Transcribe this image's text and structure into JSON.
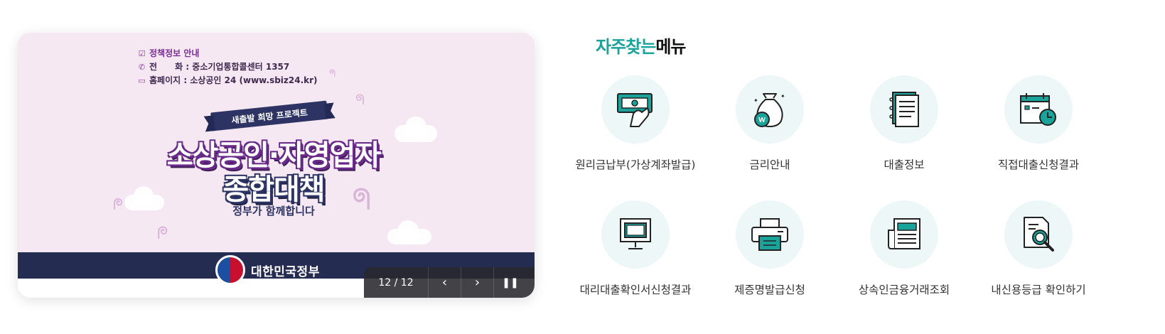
{
  "banner": {
    "info_title": "정책정보 안내",
    "phone_label": "전      화 : 중소기업통합콜센터 1357",
    "homepage_label": "홈페이지 : 소상공인 24 (www.sbiz24.kr)",
    "ribbon": "새출발 희망 프로젝트",
    "headline_line1": "소상공인·자영업자",
    "headline_line2": "종합대책",
    "tagline": "정부가 함께합니다",
    "gov_name": "대한민국정부",
    "counter": "12 / 12",
    "colors": {
      "navy": "#252c52",
      "purple": "#6a2a8a",
      "bg": "#f6e8f3"
    }
  },
  "quick_menu": {
    "title_accent": "자주찾는",
    "title_rest": "메뉴",
    "accent_color": "#1aa39a",
    "items": [
      {
        "label": "원리금납부(가상계좌발급)",
        "icon": "money-hand-icon"
      },
      {
        "label": "금리안내",
        "icon": "money-bag-icon"
      },
      {
        "label": "대출정보",
        "icon": "document-icon"
      },
      {
        "label": "직접대출신청결과",
        "icon": "calendar-clock-icon"
      },
      {
        "label": "대리대출확인서신청결과",
        "icon": "monitor-icon"
      },
      {
        "label": "제증명발급신청",
        "icon": "printer-icon"
      },
      {
        "label": "상속인금융거래조회",
        "icon": "newspaper-icon"
      },
      {
        "label": "내신용등급 확인하기",
        "icon": "document-search-icon"
      }
    ]
  }
}
